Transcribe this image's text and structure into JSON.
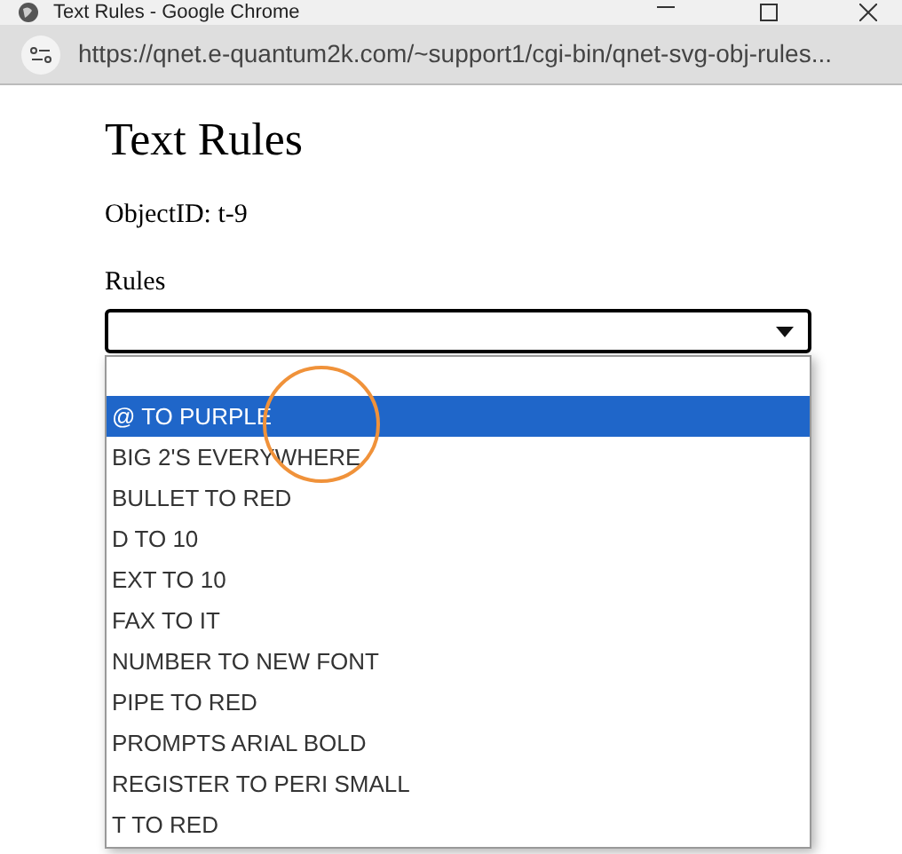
{
  "window": {
    "title": "Text Rules - Google Chrome"
  },
  "address_bar": {
    "url": "https://qnet.e-quantum2k.com/~support1/cgi-bin/qnet-svg-obj-rules..."
  },
  "page": {
    "heading": "Text Rules",
    "object_id": "ObjectID: t-9",
    "rules_label": "Rules"
  },
  "rules_dropdown": {
    "expanded": true,
    "options": [
      {
        "label": "@ TO PURPLE",
        "selected": true
      },
      {
        "label": "BIG 2'S EVERYWHERE",
        "selected": false
      },
      {
        "label": "BULLET TO RED",
        "selected": false
      },
      {
        "label": "D TO 10",
        "selected": false
      },
      {
        "label": "EXT TO 10",
        "selected": false
      },
      {
        "label": "FAX TO IT",
        "selected": false
      },
      {
        "label": "NUMBER TO NEW FONT",
        "selected": false
      },
      {
        "label": "PIPE TO RED",
        "selected": false
      },
      {
        "label": "PROMPTS ARIAL BOLD",
        "selected": false
      },
      {
        "label": "REGISTER TO PERI SMALL",
        "selected": false
      },
      {
        "label": "T TO RED",
        "selected": false
      }
    ]
  }
}
